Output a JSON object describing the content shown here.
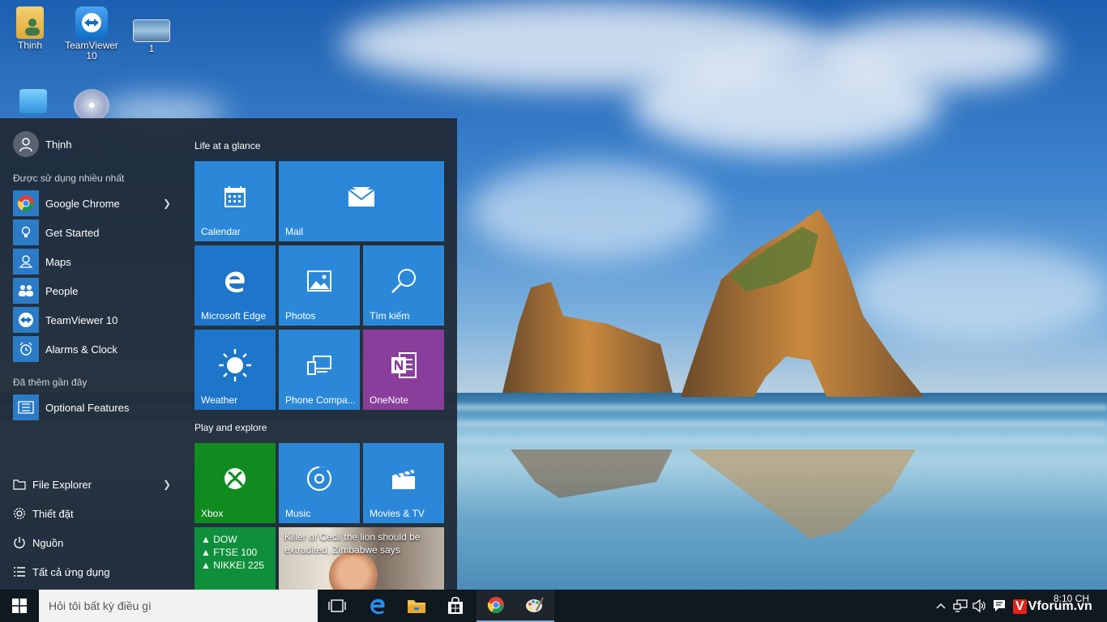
{
  "desktop": {
    "icons": [
      {
        "label": "Thịnh",
        "icon": "user-folder-icon"
      },
      {
        "label": "TeamViewer 10",
        "icon": "teamviewer-icon"
      },
      {
        "label": "1",
        "icon": "image-file-icon"
      }
    ]
  },
  "start_menu": {
    "user": {
      "name": "Thịnh"
    },
    "most_used_title": "Được sử dụng nhiều nhất",
    "most_used": [
      {
        "label": "Google Chrome",
        "icon": "chrome-icon",
        "has_submenu": true
      },
      {
        "label": "Get Started",
        "icon": "lightbulb-icon"
      },
      {
        "label": "Maps",
        "icon": "maps-icon"
      },
      {
        "label": "People",
        "icon": "people-icon"
      },
      {
        "label": "TeamViewer 10",
        "icon": "teamviewer-icon"
      },
      {
        "label": "Alarms & Clock",
        "icon": "alarm-clock-icon"
      }
    ],
    "recent_title": "Đã thêm gần đây",
    "recent": [
      {
        "label": "Optional Features",
        "icon": "optional-features-icon"
      }
    ],
    "system": [
      {
        "label": "File Explorer",
        "icon": "file-explorer-icon",
        "has_submenu": true
      },
      {
        "label": "Thiết đặt",
        "icon": "settings-gear-icon"
      },
      {
        "label": "Nguồn",
        "icon": "power-icon"
      },
      {
        "label": "Tất cả ứng dụng",
        "icon": "all-apps-list-icon"
      }
    ],
    "groups": [
      {
        "title": "Life at a glance"
      },
      {
        "title": "Play and explore"
      }
    ],
    "tiles": {
      "calendar": "Calendar",
      "mail": "Mail",
      "edge": "Microsoft Edge",
      "photos": "Photos",
      "search": "Tìm kiếm",
      "weather": "Weather",
      "phone": "Phone Compa...",
      "onenote": "OneNote",
      "xbox": "Xbox",
      "music": "Music",
      "movies": "Movies & TV",
      "money": [
        "▲ DOW",
        "▲ FTSE 100",
        "▲ NIKKEI 225"
      ],
      "news": "Killer of Cecil the lion should be extradited, Zimbabwe says"
    }
  },
  "taskbar": {
    "search_placeholder": "Hỏi tôi bất kỳ điều gì",
    "apps": [
      {
        "icon": "task-view-icon"
      },
      {
        "icon": "edge-icon"
      },
      {
        "icon": "file-explorer-icon"
      },
      {
        "icon": "store-icon"
      },
      {
        "icon": "chrome-icon"
      },
      {
        "icon": "paint-icon"
      }
    ],
    "tray_icons": [
      "chevron-up-icon",
      "network-icon",
      "volume-icon",
      "action-center-icon"
    ],
    "clock_time": "8:10 CH",
    "watermark": "Vforum.vn"
  },
  "colors": {
    "start_bg": "#1f2936",
    "tile_blue": "#2b88d8",
    "tile_purple": "#8a3e9c",
    "tile_green": "#0f8b1f",
    "taskbar_bg": "#101820"
  }
}
